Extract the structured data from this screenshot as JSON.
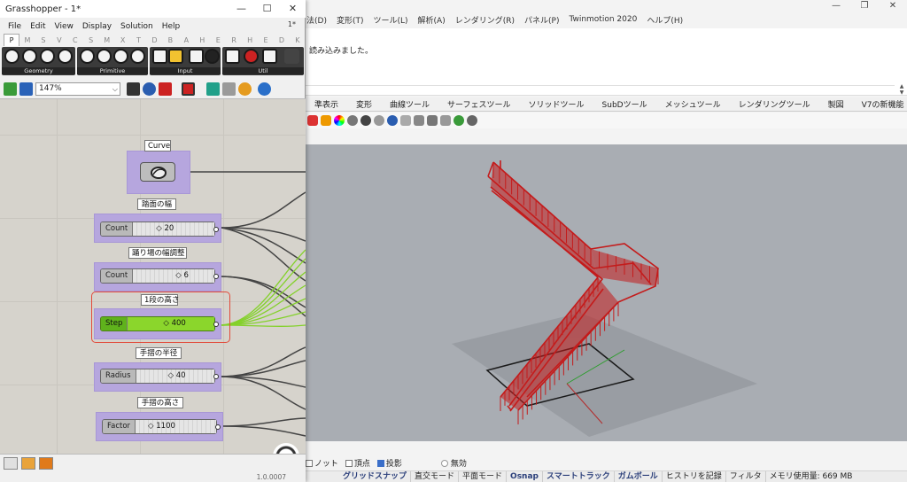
{
  "rhino": {
    "menus": [
      "法(D)",
      "変形(T)",
      "ツール(L)",
      "解析(A)",
      "レンダリング(R)",
      "パネル(P)",
      "Twinmotion 2020",
      "ヘルプ(H)"
    ],
    "command_history": "読み込みました。",
    "tabs": [
      "準表示",
      "変形",
      "曲線ツール",
      "サーフェスツール",
      "ソリッドツール",
      "SubDツール",
      "メッシュツール",
      "レンダリングツール",
      "製図",
      "V7の新機能"
    ],
    "osnap": {
      "items": [
        {
          "label": "ノット",
          "checked": false
        },
        {
          "label": "頂点",
          "checked": false
        },
        {
          "label": "投影",
          "checked": true
        }
      ],
      "disable_label": "無効"
    },
    "status": [
      {
        "label": "グリッドスナップ",
        "bold": true
      },
      {
        "label": "直交モード",
        "bold": false
      },
      {
        "label": "平面モード",
        "bold": false
      },
      {
        "label": "Osnap",
        "bold": true
      },
      {
        "label": "スマートトラック",
        "bold": true
      },
      {
        "label": "ガムボール",
        "bold": true
      },
      {
        "label": "ヒストリを記録",
        "bold": false
      },
      {
        "label": "フィルタ",
        "bold": false
      },
      {
        "label": "メモリ使用量: 669 MB",
        "bold": false
      }
    ]
  },
  "grasshopper": {
    "title": "Grasshopper - 1*",
    "doc_indicator": "1*",
    "menus": [
      "File",
      "Edit",
      "View",
      "Display",
      "Solution",
      "Help"
    ],
    "tabs": [
      "P",
      "M",
      "S",
      "V",
      "C",
      "S",
      "M",
      "X",
      "T",
      "D",
      "B",
      "A",
      "H",
      "E",
      "R",
      "H",
      "E",
      "D",
      "K"
    ],
    "active_tab": 0,
    "ribbon_groups": [
      "Geometry",
      "Primitive",
      "Input",
      "Util"
    ],
    "zoom": "147%",
    "version": "1.0.0007",
    "components": [
      {
        "group_label": "Curve"
      },
      {
        "group_label": "踏面の幅",
        "slider_name": "Count",
        "value": "20"
      },
      {
        "group_label": "踊り場の幅調整",
        "slider_name": "Count",
        "value": "6"
      },
      {
        "group_label": "1段の高さ",
        "slider_name": "Step",
        "value": "400",
        "selected": true
      },
      {
        "group_label": "手摺の半径",
        "slider_name": "Radius",
        "value": "40"
      },
      {
        "group_label": "手摺の高さ",
        "slider_name": "Factor",
        "value": "1100"
      }
    ]
  },
  "colors": {
    "group_fill": "#b6a6de",
    "selected_slider": "#8bd62c",
    "selection_outline": "#e24a3a",
    "stair_red": "#c41b1b",
    "viewport_bg": "#a9adb3"
  }
}
